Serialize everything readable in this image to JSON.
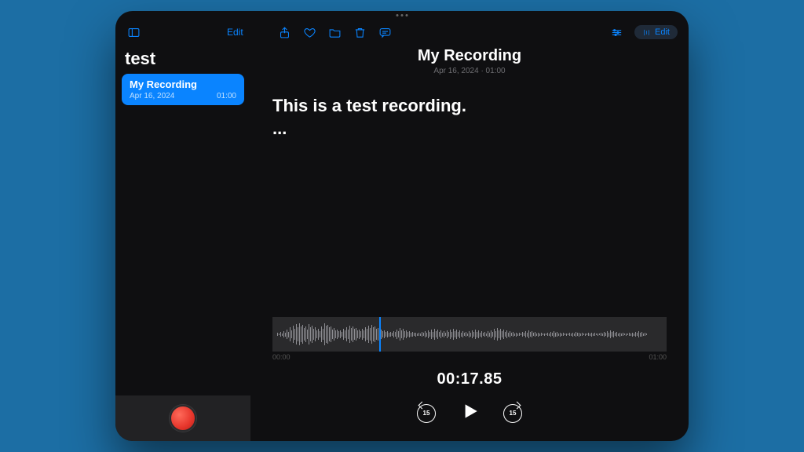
{
  "toolbar": {
    "edit_left": "Edit",
    "edit_right": "Edit"
  },
  "sidebar": {
    "folder_title": "test",
    "items": [
      {
        "name": "My Recording",
        "date": "Apr 16, 2024",
        "duration": "01:00"
      }
    ]
  },
  "detail": {
    "title": "My Recording",
    "subtitle": "Apr 16, 2024 · 01:00",
    "transcript": "This is a test recording.",
    "ellipsis": "...",
    "time_start": "00:00",
    "time_end": "01:00",
    "current_time": "00:17.85",
    "skip_seconds": "15"
  }
}
